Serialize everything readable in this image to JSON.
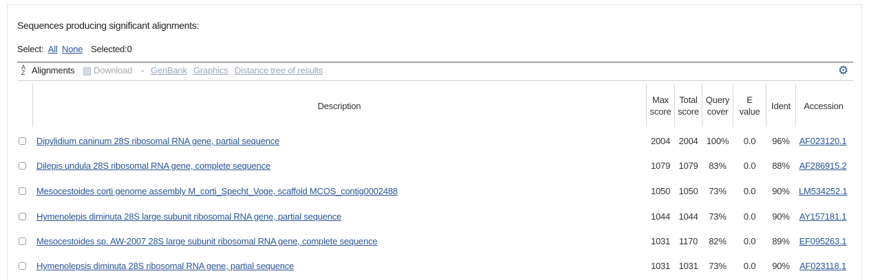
{
  "title": "Sequences producing significant alignments:",
  "select": {
    "prefix": "Select:",
    "all": "All",
    "none": "None",
    "selected": "Selected:0"
  },
  "toolbar": {
    "sort_icon": "sort-icon",
    "alignments": "Alignments",
    "download": "Download",
    "download_chevron": "⌄",
    "genbank": "GenBank",
    "graphics": "Graphics",
    "distance_tree": "Distance tree of results",
    "settings_icon": "gear-icon"
  },
  "columns": {
    "description": "Description",
    "max_score": [
      "Max",
      "score"
    ],
    "total_score": [
      "Total",
      "score"
    ],
    "query_cover": [
      "Query",
      "cover"
    ],
    "e_value": [
      "E",
      "value"
    ],
    "ident": "Ident",
    "accession": "Accession"
  },
  "rows": [
    {
      "description": "Dipylidium caninum 28S ribosomal RNA gene, partial sequence",
      "max_score": "2004",
      "total_score": "2004",
      "query_cover": "100%",
      "e_value": "0.0",
      "ident": "96%",
      "accession": "AF023120.1"
    },
    {
      "description": "Dilepis undula 28S ribosomal RNA gene, complete sequence",
      "max_score": "1079",
      "total_score": "1079",
      "query_cover": "83%",
      "e_value": "0.0",
      "ident": "88%",
      "accession": "AF286915.2"
    },
    {
      "description": "Mesocestoides corti genome assembly M_corti_Specht_Voge, scaffold MCOS_contig0002488",
      "max_score": "1050",
      "total_score": "1050",
      "query_cover": "73%",
      "e_value": "0.0",
      "ident": "90%",
      "accession": "LM534252.1"
    },
    {
      "description": "Hymenolepis diminuta 28S large subunit ribosomal RNA gene, partial sequence",
      "max_score": "1044",
      "total_score": "1044",
      "query_cover": "73%",
      "e_value": "0.0",
      "ident": "90%",
      "accession": "AY157181.1"
    },
    {
      "description": "Mesocestoides sp. AW-2007 28S large subunit ribosomal RNA gene, complete sequence",
      "max_score": "1031",
      "total_score": "1170",
      "query_cover": "82%",
      "e_value": "0.0",
      "ident": "89%",
      "accession": "EF095263.1"
    },
    {
      "description": "Hymenolepsis diminuta 28S ribosomal RNA gene, partial sequence",
      "max_score": "1031",
      "total_score": "1031",
      "query_cover": "73%",
      "e_value": "0.0",
      "ident": "90%",
      "accession": "AF023118.1"
    }
  ],
  "colors": {
    "link": "#2a5599",
    "disabled_link": "#9aa8bb",
    "gear": "#2c5b8e"
  }
}
